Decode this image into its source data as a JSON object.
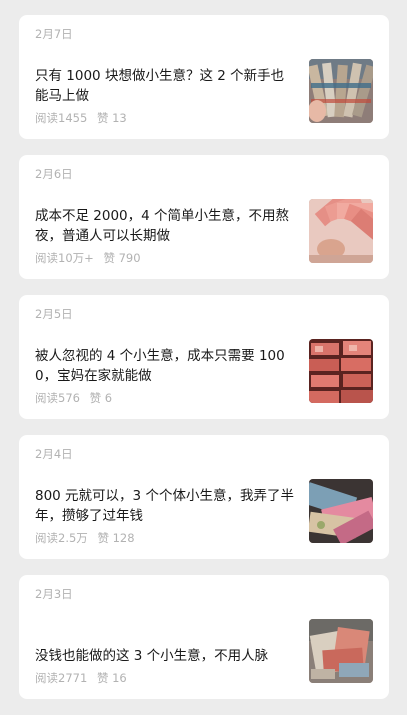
{
  "articles": [
    {
      "date": "2月7日",
      "title": "只有 1000 块想做小生意？这 2 个新手也能马上做",
      "read_label": "阅读",
      "reads": "1455",
      "like_label": "赞",
      "likes": "13",
      "thumb_icon": "money-bundles-photo"
    },
    {
      "date": "2月6日",
      "title": "成本不足 2000，4 个简单小生意，不用熬夜，普通人可以长期做",
      "read_label": "阅读",
      "reads": "10万+",
      "like_label": "赞",
      "likes": "790",
      "thumb_icon": "cash-fan-photo"
    },
    {
      "date": "2月5日",
      "title": "被人忽视的 4 个小生意，成本只需要 1000，宝妈在家就能做",
      "read_label": "阅读",
      "reads": "576",
      "like_label": "赞",
      "likes": "6",
      "thumb_icon": "cash-stacks-photo"
    },
    {
      "date": "2月4日",
      "title": "800 元就可以，3 个个体小生意，我弄了半年，攒够了过年钱",
      "read_label": "阅读",
      "reads": "2.5万",
      "like_label": "赞",
      "likes": "128",
      "thumb_icon": "banknotes-pile-photo"
    },
    {
      "date": "2月3日",
      "title": "没钱也能做的这 3 个小生意，不用人脉",
      "read_label": "阅读",
      "reads": "2771",
      "like_label": "赞",
      "likes": "16",
      "thumb_icon": "money-on-desk-photo"
    }
  ]
}
